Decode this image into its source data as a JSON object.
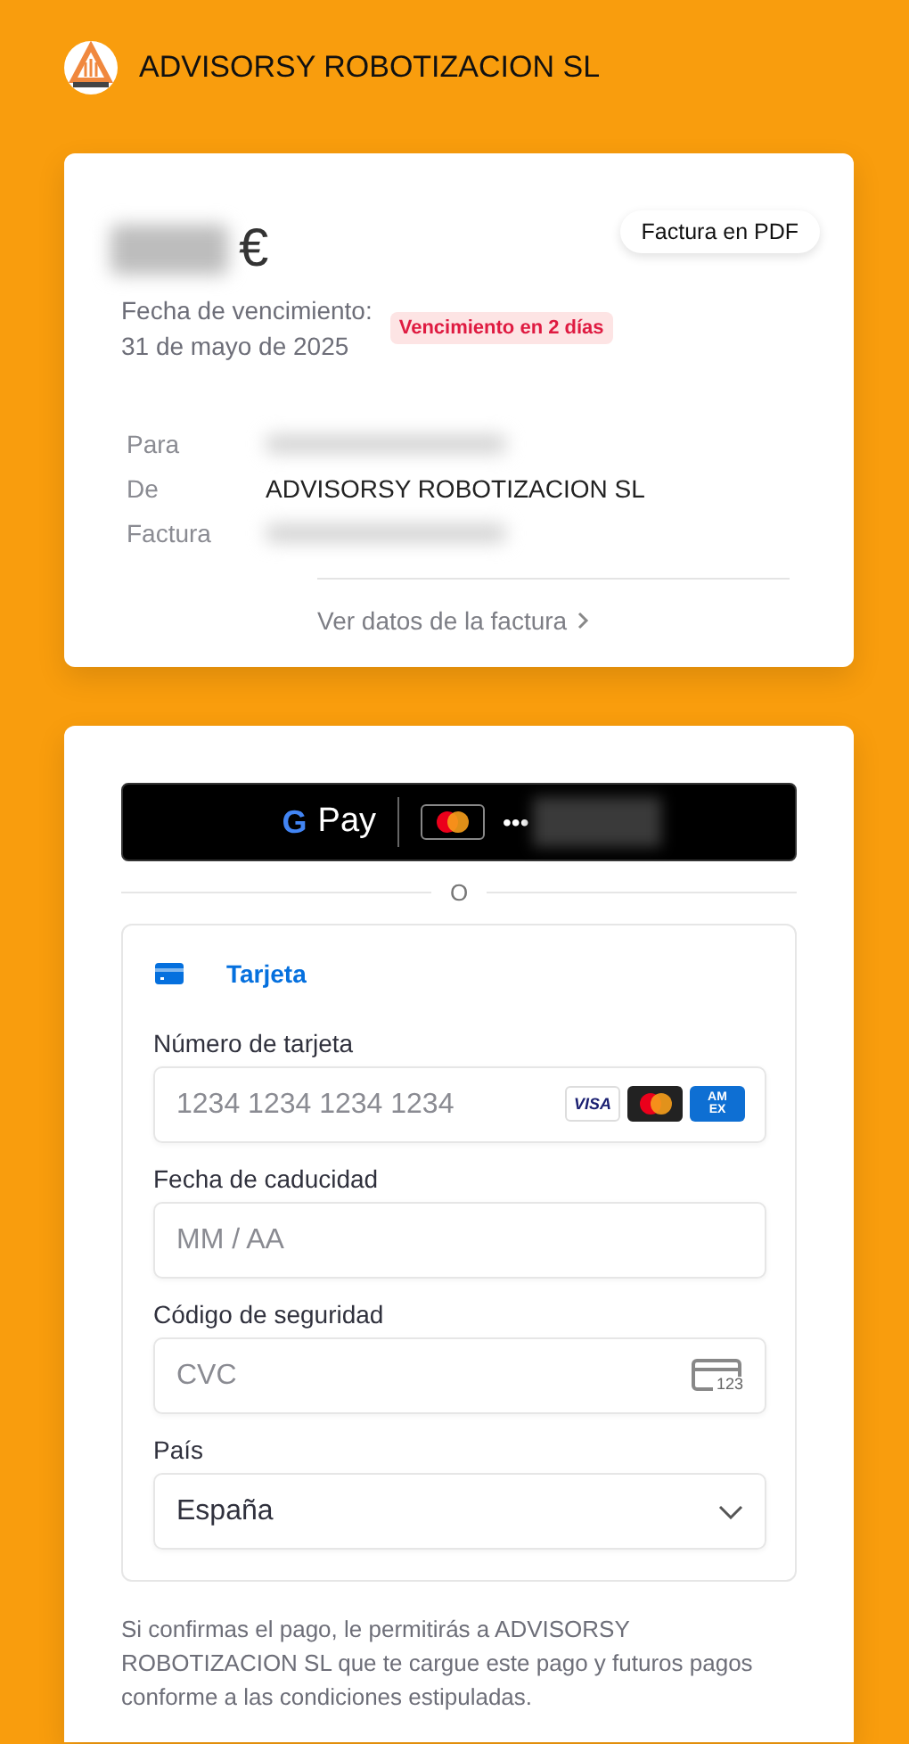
{
  "header": {
    "company": "ADVISORSY ROBOTIZACION SL"
  },
  "invoice": {
    "amount": {
      "redacted": true,
      "currency": "€"
    },
    "pdf_button": "Factura en PDF",
    "due_label": "Fecha de vencimiento:",
    "due_date": "31 de mayo de 2025",
    "badge": "Vencimiento en 2 días",
    "details": [
      {
        "label": "Para",
        "redacted": true
      },
      {
        "label": "De",
        "value": "ADVISORSY ROBOTIZACION SL",
        "redacted": false
      },
      {
        "label": "Factura",
        "redacted": true
      }
    ],
    "details_link": "Ver datos de la factura"
  },
  "payment": {
    "wallet_button": {
      "logo_letter": "G",
      "label": "Pay",
      "card_dots": "•••",
      "card_redacted": true
    },
    "separator": "O",
    "methods": [
      {
        "label": "Tarjeta",
        "selected": true
      }
    ],
    "fields": [
      {
        "kind": "card",
        "label": "Número de tarjeta",
        "placeholder": "1234 1234 1234 1234",
        "brands": [
          {
            "kind": "visa",
            "text": "VISA"
          },
          {
            "kind": "mastercard"
          },
          {
            "kind": "amex",
            "lines": [
              "AM",
              "EX"
            ]
          }
        ]
      },
      {
        "kind": "text",
        "label": "Fecha de caducidad",
        "placeholder": "MM / AA"
      },
      {
        "kind": "cvc",
        "label": "Código de seguridad",
        "placeholder": "CVC",
        "icon_text": "123"
      },
      {
        "kind": "select",
        "label": "País",
        "value": "España"
      }
    ],
    "consent": "Si confirmas el pago, le permitirás a ADVISORSY ROBOTIZACION SL que te cargue este pago y futuros pagos conforme a las condiciones estipuladas."
  }
}
